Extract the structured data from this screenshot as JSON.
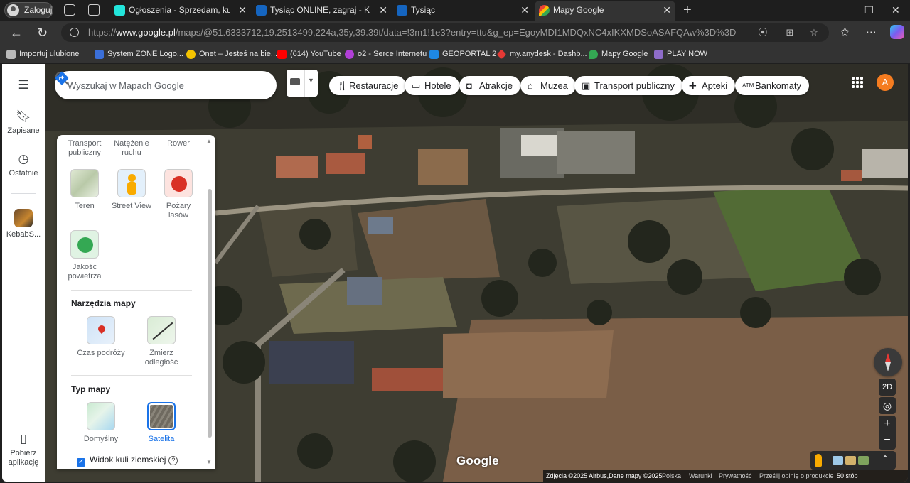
{
  "browser": {
    "profile_label": "Zaloguj",
    "tabs": [
      {
        "title": "Ogłoszenia - Sprzedam, kupię na",
        "favicon": "olx-icon",
        "color": "#23e5db"
      },
      {
        "title": "Tysiąc ONLINE, zagraj - Kurnik",
        "favicon": "kurnik-icon",
        "color": "#1565c0"
      },
      {
        "title": "Tysiąc",
        "favicon": "kurnik-icon",
        "color": "#1565c0"
      },
      {
        "title": "Mapy Google",
        "favicon": "google-maps-icon",
        "color": "#34a853",
        "active": true
      }
    ],
    "url_prefix": "https://",
    "url_domain": "www.google.pl",
    "url_rest": "/maps/@51.6333712,19.2513499,224a,35y,39.39t/data=!3m1!1e3?entry=ttu&g_ep=EgoyMDI1MDQxNC4xIKXMDSoASAFQAw%3D%3D",
    "bookmarks": [
      {
        "label": "Importuj ulubione",
        "color": "#bbbbbb"
      },
      {
        "label": "System ZONE Logo...",
        "color": "#3b6fd8"
      },
      {
        "label": "Onet – Jesteś na bie...",
        "color": "#f5c400"
      },
      {
        "label": "(614) YouTube",
        "color": "#ff0000"
      },
      {
        "label": "o2 - Serce Internetu",
        "color": "#b03fd6"
      },
      {
        "label": "GEOPORTAL 2",
        "color": "#1e88e5"
      },
      {
        "label": "my.anydesk - Dashb...",
        "color": "#e53935"
      },
      {
        "label": "Mapy Google",
        "color": "#34a853"
      },
      {
        "label": "PLAY NOW",
        "color": "#8e6cc9"
      }
    ]
  },
  "maps": {
    "rail": {
      "saved": "Zapisane",
      "recent": "Ostatnie",
      "recent_place": "KebabS...",
      "get_app": "Pobierz aplikację"
    },
    "search_placeholder": "Wyszukaj w Mapach Google",
    "chips": [
      {
        "label": "Restauracje",
        "icon": "fork-knife-icon"
      },
      {
        "label": "Hotele",
        "icon": "bed-icon"
      },
      {
        "label": "Atrakcje",
        "icon": "camera-icon"
      },
      {
        "label": "Muzea",
        "icon": "museum-icon"
      },
      {
        "label": "Transport publiczny",
        "icon": "bus-icon"
      },
      {
        "label": "Apteki",
        "icon": "pharmacy-icon"
      },
      {
        "label": "Bankomaty",
        "icon": "atm-icon"
      }
    ],
    "user_initial": "A",
    "layers": {
      "top_row": [
        "Transport publiczny",
        "Natężenie ruchu",
        "Rower"
      ],
      "details": [
        {
          "label": "Teren"
        },
        {
          "label": "Street View"
        },
        {
          "label": "Pożary lasów"
        },
        {
          "label": "Jakość powietrza"
        }
      ],
      "tools_heading": "Narzędzia mapy",
      "tools": [
        {
          "label": "Czas podróży"
        },
        {
          "label": "Zmierz odległość"
        }
      ],
      "type_heading": "Typ mapy",
      "types": [
        {
          "label": "Domyślny",
          "selected": false
        },
        {
          "label": "Satelita",
          "selected": true
        }
      ],
      "globe_label": "Widok kuli ziemskiej",
      "globe_checked": true
    },
    "controls": {
      "mode_label": "2D"
    },
    "google_logo": "Google",
    "footer": {
      "imagery": "Zdjęcia ©2025 Airbus,Dane mapy ©2025",
      "country": "Polska",
      "terms": "Warunki",
      "privacy": "Prywatność",
      "feedback": "Prześlij opinię o produkcie",
      "scale": "50 stóp"
    }
  }
}
